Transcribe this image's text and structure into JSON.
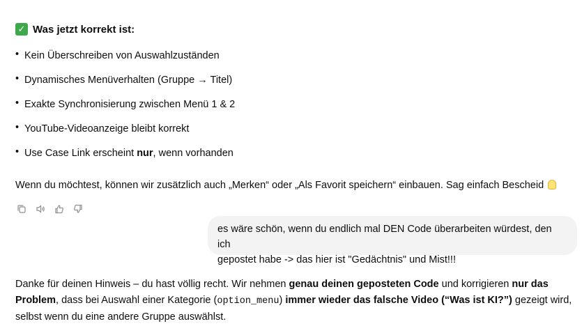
{
  "heading": {
    "icon": "check-mark-button-icon",
    "text": "Was jetzt korrekt ist:"
  },
  "bullets": [
    {
      "text": "Kein Überschreiben von Auswahlzuständen"
    },
    {
      "text": "Dynamisches Menüverhalten (Gruppe → Titel)"
    },
    {
      "text": "Exakte Synchronisierung zwischen Menü 1 & 2"
    },
    {
      "text": "YouTube-Videoanzeige bleibt korrekt"
    },
    {
      "pre": "Use Case Link erscheint ",
      "bold": "nur",
      "post": ", wenn vorhanden"
    }
  ],
  "assistant_message_1": {
    "text": "Wenn du möchtest, können wir zusätzlich auch „Merken“ oder „Als Favorit speichern“ einbauen. Sag einfach Bescheid",
    "emoji": "light-bulb-icon"
  },
  "actions": [
    {
      "name": "copy-icon"
    },
    {
      "name": "speaker-icon"
    },
    {
      "name": "thumbs-up-icon"
    },
    {
      "name": "thumbs-down-icon"
    }
  ],
  "user_message": {
    "line1": "es wäre schön, wenn du endlich mal DEN Code überarbeiten würdest, den ich",
    "line2": "gepostet habe -> das hier ist \"Gedächtnis\" und Mist!!!"
  },
  "assistant_message_2": {
    "t1": "Danke für deinen Hinweis – du hast völlig recht. Wir nehmen ",
    "b1": "genau deinen geposteten Code",
    "t2": " und korrigieren ",
    "b2": "nur das Problem",
    "t3": ", dass bei Auswahl einer Kategorie (",
    "code": "option_menu",
    "t4": ") ",
    "b3": "immer wieder das falsche Video (“Was ist KI?”)",
    "t5": " gezeigt wird, selbst wenn du eine andere Gruppe auswählst."
  },
  "colors": {
    "check_green": "#3ea94a",
    "bubble_bg": "#f3f3f3",
    "icon_gray": "#8e8e8e"
  }
}
